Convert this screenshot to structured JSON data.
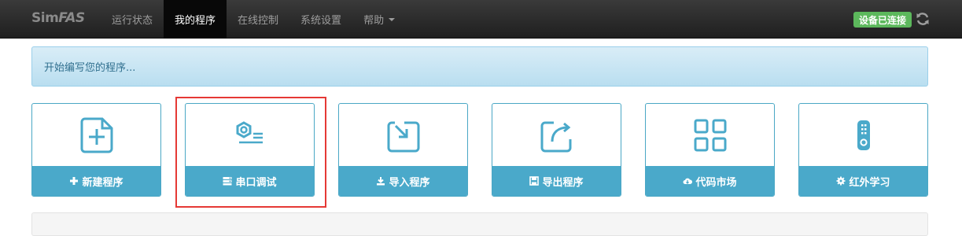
{
  "brand": {
    "part1": "Sim",
    "part2": "FAS"
  },
  "nav": [
    {
      "label": "运行状态"
    },
    {
      "label": "我的程序"
    },
    {
      "label": "在线控制"
    },
    {
      "label": "系统设置"
    },
    {
      "label": "帮助"
    }
  ],
  "status_badge": "设备已连接",
  "alert_text": "开始编写您的程序...",
  "cards": [
    {
      "label": "新建程序",
      "icon": "new-file-icon"
    },
    {
      "label": "串口调试",
      "icon": "serial-debug-icon"
    },
    {
      "label": "导入程序",
      "icon": "import-icon"
    },
    {
      "label": "导出程序",
      "icon": "export-icon"
    },
    {
      "label": "代码市场",
      "icon": "grid-icon"
    },
    {
      "label": "红外学习",
      "icon": "remote-icon"
    }
  ],
  "colors": {
    "accent": "#4aa9ca",
    "navbar": "#222222",
    "success": "#5cb85c",
    "highlight": "#e53935"
  }
}
